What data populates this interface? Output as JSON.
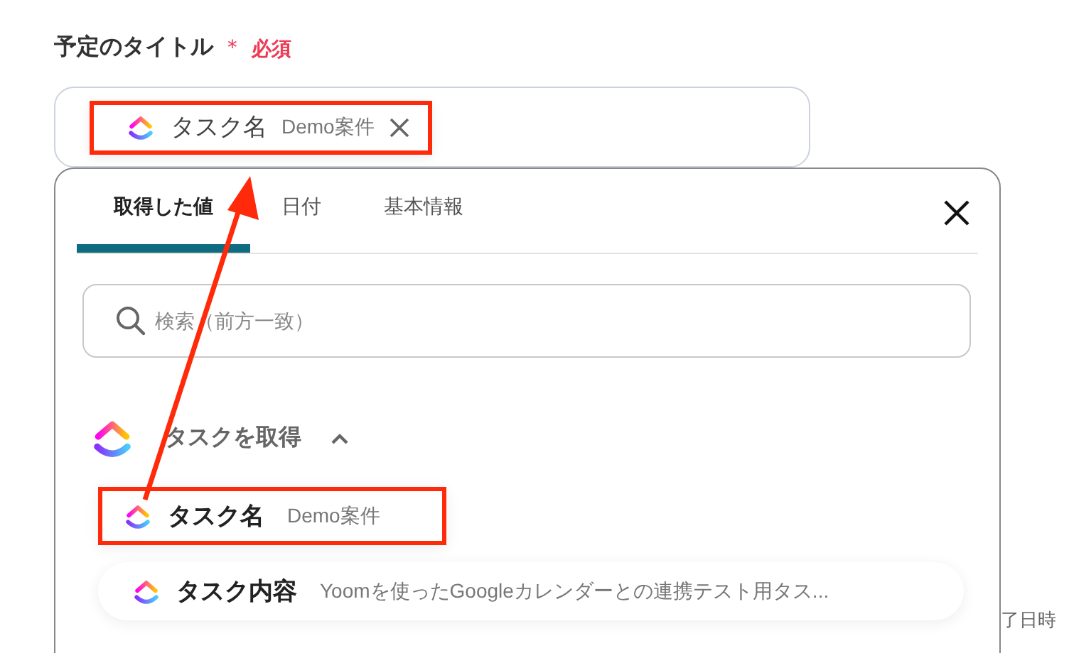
{
  "field": {
    "label": "予定のタイトル",
    "required_mark": "＊",
    "required_text": "必須",
    "chip": {
      "name": "タスク名",
      "value": "Demo案件",
      "highlighted": true
    }
  },
  "panel": {
    "tabs": [
      {
        "label": "取得した値",
        "selected": true
      },
      {
        "label": "日付",
        "selected": false
      },
      {
        "label": "基本情報",
        "selected": false
      }
    ],
    "search": {
      "placeholder": "検索（前方一致）"
    },
    "section": {
      "title": "タスクを取得",
      "expanded": true
    },
    "items": [
      {
        "name": "タスク名",
        "value": "Demo案件",
        "highlighted": true
      },
      {
        "name": "タスク内容",
        "value": "Yoomを使ったGoogleカレンダーとの連携テスト用タス...",
        "highlighted": false
      }
    ]
  },
  "side_text": "了日時"
}
